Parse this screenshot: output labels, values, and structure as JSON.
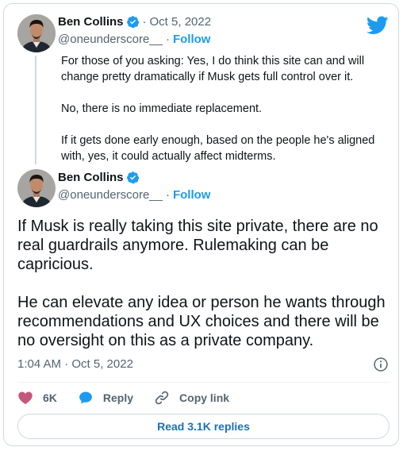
{
  "parent_tweet": {
    "author_name": "Ben Collins",
    "separator": "·",
    "date": "Oct 5, 2022",
    "handle": "@oneunderscore__",
    "follow_label": "Follow",
    "paragraphs": [
      "For those of you asking: Yes, I do think this site can and will change pretty dramatically if Musk gets full control over it.",
      "No, there is no immediate replacement.",
      "If it gets done early enough, based on the people he's aligned with, yes, it could actually affect midterms."
    ]
  },
  "main_tweet": {
    "author_name": "Ben Collins",
    "separator": "·",
    "handle": "@oneunderscore__",
    "follow_label": "Follow",
    "paragraphs": [
      "If Musk is really taking this site private, there are no real guardrails anymore. Rulemaking can be capricious.",
      "He can elevate any idea or person he wants through recommendations and UX choices and there will be no oversight on this as a private company."
    ],
    "timestamp": "1:04 AM · Oct 5, 2022"
  },
  "actions": {
    "like_count": "6K",
    "reply_label": "Reply",
    "copy_link_label": "Copy link"
  },
  "read_replies_label": "Read 3.1K replies",
  "colors": {
    "brand_blue": "#1d9bf0",
    "like_pink": "#c4587a",
    "text_secondary": "#536471"
  }
}
